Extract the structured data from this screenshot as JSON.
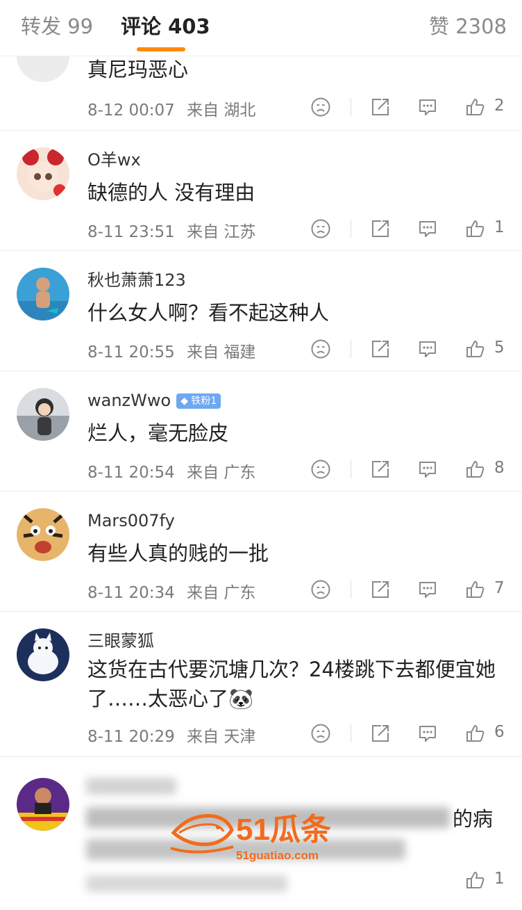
{
  "tabs": {
    "repost": "转发 99",
    "comments": "评论 403",
    "likes": "赞 2308"
  },
  "comments": [
    {
      "user": "",
      "text": "真尼玛恶心",
      "date": "8-12 00:07",
      "location": "来自 湖北",
      "likes": "2"
    },
    {
      "user": "O羊wx",
      "text": "缺德的人 没有理由",
      "date": "8-11 23:51",
      "location": "来自 江苏",
      "likes": "1"
    },
    {
      "user": "秋也萧萧123",
      "text": "什么女人啊？看不起这种人",
      "date": "8-11 20:55",
      "location": "来自 福建",
      "likes": "5"
    },
    {
      "user": "wanzWwo",
      "badge": "铁粉1",
      "text": "烂人，毫无脸皮",
      "date": "8-11 20:54",
      "location": "来自 广东",
      "likes": "8"
    },
    {
      "user": "Mars007fy",
      "text": "有些人真的贱的一批",
      "date": "8-11 20:34",
      "location": "来自 广东",
      "likes": "7"
    },
    {
      "user": "三眼蒙狐",
      "text": "这货在古代要沉塘几次？24楼跳下去都便宜她了……太恶心了",
      "emoji": "🐼",
      "date": "8-11 20:29",
      "location": "来自 天津",
      "likes": "6"
    },
    {
      "user": "",
      "text_tail": "的病",
      "likes": "1"
    }
  ],
  "watermark": {
    "brand": "51瓜条",
    "url": "51guatiao.com"
  }
}
